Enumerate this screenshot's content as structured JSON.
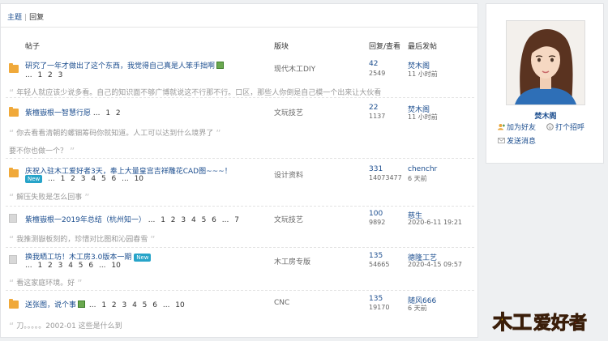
{
  "tabs": {
    "topic": "主题",
    "reply": "回复"
  },
  "headers": {
    "post": "帖子",
    "forum": "版块",
    "reply_view": "回复/查看",
    "last_post": "最后发帖"
  },
  "threads": [
    {
      "icon": "folder-icon",
      "title": "研究了一年才做出了这个东西，我觉得自己真是人笨手拙啊",
      "pages": "... 1 2 3",
      "forum": "现代木工DIY",
      "replies": "42",
      "views": "2549",
      "last_user": "焚木阁",
      "last_time": "11 小时前",
      "quote": "年轻人就应该少说多看。自己的知识面不够广博就说这不行那不行。口区，那些人你倒是自己模一个出来让大伙看"
    },
    {
      "icon": "folder-icon",
      "title": "紫檀嶽根一智慧行愿",
      "pages": "... 1 2",
      "forum": "文玩技艺",
      "replies": "22",
      "views": "1137",
      "last_user": "焚木阁",
      "last_time": "11 小时前",
      "quote": "你去看看清朝的螺钿筹码你就知道。人工可以达到什么境界了",
      "quote2": "要不你也做一个？"
    },
    {
      "icon": "folder-icon",
      "title": "庆祝入驻木工爱好者3天，奉上大量皇宫吉祥雕花CAD图~~~！",
      "new": "New",
      "pages": "... 1 2 3 4 5 6 ... 10",
      "forum": "设计资料",
      "replies": "331",
      "views": "14073477",
      "last_user": "chenchr",
      "last_time": "6 天前",
      "quote": "解压失败是怎么回事"
    },
    {
      "icon": "doc-icon",
      "title": "紫檀嶽根一2019年总结（杭州知一）",
      "pages": "... 1 2 3 4 5 6 ... 7",
      "forum": "文玩技艺",
      "replies": "100",
      "views": "9892",
      "last_user": "慈生",
      "last_time": "2020-6-11 19:21",
      "quote": "我推测嶽板刻的，珍惜对比图和沁园春雪"
    },
    {
      "icon": "doc-icon",
      "title": "换我晒工坊！木工房3.0版本一期",
      "new": "New",
      "pages": "... 1 2 3 4 5 6 ... 10",
      "forum": "木工房专版",
      "replies": "135",
      "views": "54665",
      "last_user": "德隆工艺",
      "last_time": "2020-4-15 09:57",
      "quote": "看这家庭环境。好"
    },
    {
      "icon": "folder-icon",
      "title": "送张图，说个事",
      "pages": "... 1 2 3 4 5 6 ... 10",
      "forum": "CNC",
      "replies": "135",
      "views": "19170",
      "last_user": "随风666",
      "last_time": "6 天前",
      "quote": "刀。。。。。2002-01 这些是什么到"
    }
  ],
  "profile": {
    "name": "焚木阁",
    "add_friend": "加为好友",
    "greet": "打个招呼",
    "message": "发送消息"
  },
  "logo_text": "木工爱好者",
  "colors": {
    "link": "#1c4e8f",
    "folder": "#f0a93a",
    "badge": "#27a4c9",
    "logo_yellow": "#f5c400",
    "logo_red": "#d8261c"
  }
}
